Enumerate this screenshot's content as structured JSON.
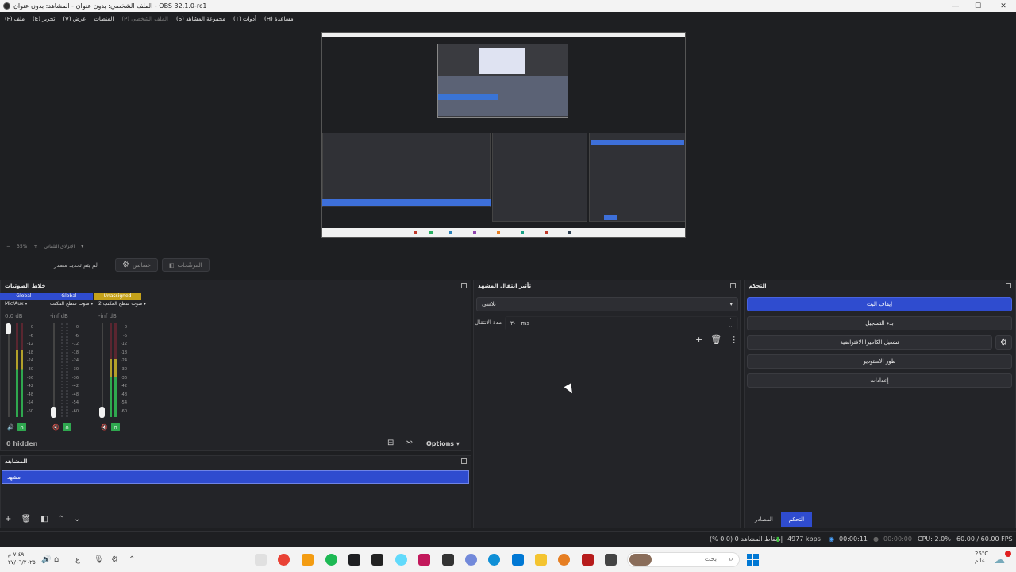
{
  "window": {
    "title": "الملف الشخصي: بدون عنوان - المشاهد: بدون عنوان - OBS 32.1.0-rc1",
    "minimize": "—",
    "maximize": "☐",
    "close": "✕"
  },
  "menu": [
    "(F) ملف",
    "(E) تحرير",
    "(V) عرض",
    "المنصات",
    "(P) الملف الشخصي",
    "(S) مجموعة المشاهد",
    "(T) أدوات",
    "(H) مساعدة"
  ],
  "zoom": {
    "minus": "−",
    "value": "35%",
    "plus": "+",
    "label": "الإنزلاق التلقائي"
  },
  "toolbar": {
    "no_source": "لم يتم تحديد مصدر",
    "properties": "خصائص",
    "filters": "المرشّحات"
  },
  "mixer": {
    "title": "خلاط الصوتيات",
    "channels": [
      {
        "tag": "Global",
        "tag_color": "#2f4ccf",
        "name": "Mic/Aux",
        "db": "0.0 dB",
        "level": 0.72,
        "fader": 0.0,
        "muted": false
      },
      {
        "tag": "Global",
        "tag_color": "#2f4ccf",
        "name": "صوت سطح المكتب",
        "db": "-inf dB",
        "level": 0.0,
        "fader": 0.95,
        "muted": true
      },
      {
        "tag": "Unassigned",
        "tag_color": "#c5a21a",
        "name": "صوت سطح المكتب 2",
        "db": "-inf dB",
        "level": 0.62,
        "fader": 0.95,
        "muted": true
      }
    ],
    "scale": [
      "0",
      "-6",
      "-12",
      "-18",
      "-24",
      "-30",
      "-36",
      "-42",
      "-48",
      "-54",
      "-60"
    ],
    "hidden": "0 hidden",
    "options": "Options"
  },
  "scenes": {
    "title": "المشاهد",
    "items": [
      "مشهد"
    ]
  },
  "transitions": {
    "title": "تأثير انتقال المشهد",
    "selected": "تلاشي",
    "duration_label": "مدة الانتقال",
    "duration_value": "٣٠٠ ms"
  },
  "controls": {
    "title": "التحكم",
    "buttons": [
      "إيقاف البث",
      "بدء التسجيل",
      "تشغيل الكاميرا الافتراضية",
      "طور الاستوديو",
      "إعدادات"
    ]
  },
  "tabs": {
    "sources": "المصادر",
    "controls": "التحكم"
  },
  "status": {
    "dropped": "إسقاط المشاهد 0 (0.0 %)",
    "bitrate": "4977 kbps",
    "stream_time": "00:00:11",
    "rec_time": "00:00:00",
    "cpu": "CPU: 2.0%",
    "fps": "60.00 / 60.00 FPS"
  },
  "taskbar": {
    "time": "٧:٤٩ م",
    "date": "٢٧/٠٦/٢٠٢٥",
    "search_placeholder": "بحث",
    "weather_temp": "25°C",
    "weather_text": "غائم"
  }
}
